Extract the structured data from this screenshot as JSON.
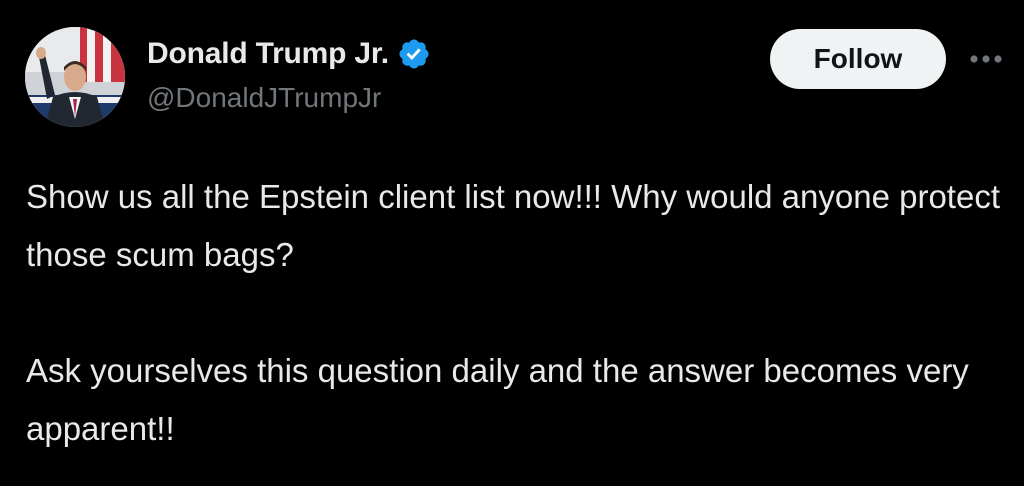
{
  "author": {
    "display_name": "Donald Trump Jr.",
    "handle": "@DonaldJTrumpJr",
    "verified": true,
    "avatar_icon": "profile-photo"
  },
  "actions": {
    "follow_label": "Follow",
    "more_icon": "more-horizontal-icon"
  },
  "tweet": {
    "paragraphs": [
      "Show us all the Epstein client list now!!! Why would anyone protect those scum bags?",
      "Ask yourselves this question daily and the answer becomes very apparent!!"
    ]
  },
  "colors": {
    "background": "#000000",
    "text": "#e7e9ea",
    "secondary_text": "#71767b",
    "verified_blue": "#1d9bf0",
    "follow_button_bg": "#eff3f4",
    "follow_button_text": "#0f1419"
  }
}
